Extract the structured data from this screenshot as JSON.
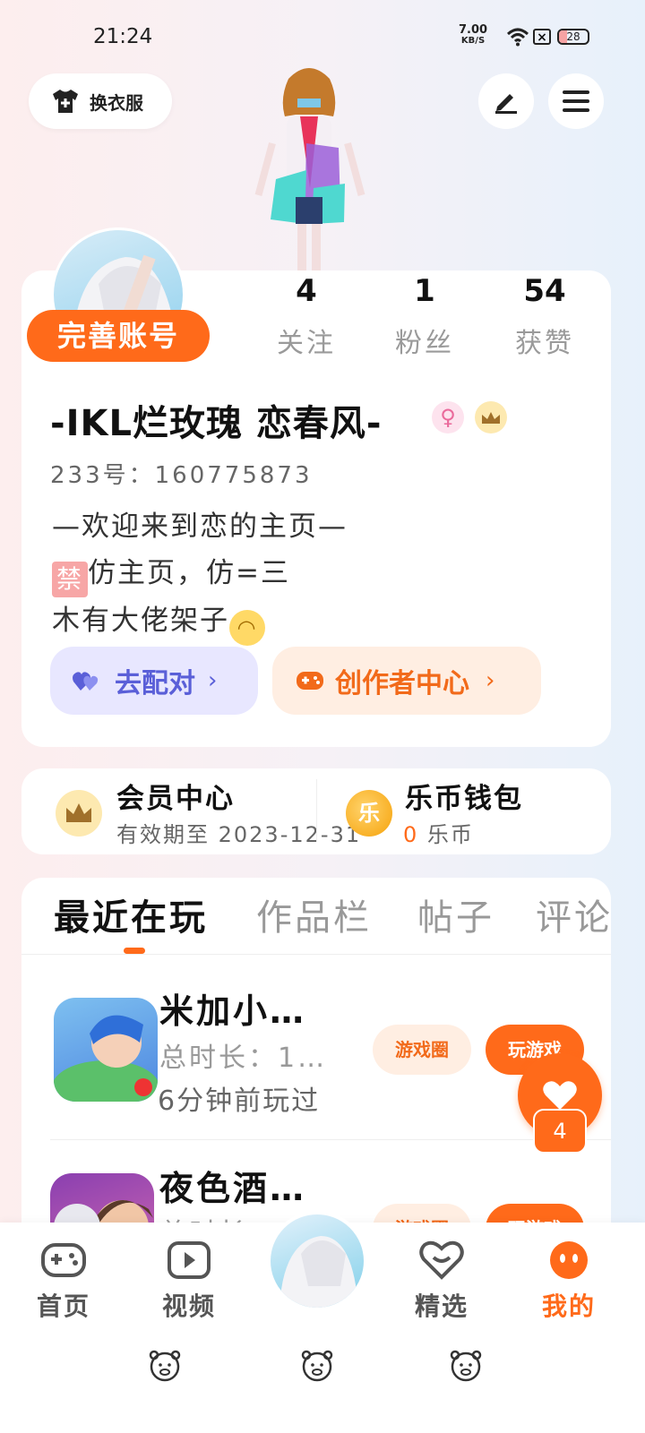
{
  "status_bar": {
    "time": "21:24",
    "net_speed": "7.00",
    "net_unit": "KB/S",
    "battery": "28",
    "battery_level": 0.28
  },
  "header": {
    "dress_label": "换衣服"
  },
  "profile": {
    "complete_badge": "完善账号",
    "stats": [
      {
        "num": "4",
        "label": "关注"
      },
      {
        "num": "1",
        "label": "粉丝"
      },
      {
        "num": "54",
        "label": "获赞"
      }
    ],
    "username": "-IKL烂玫瑰 恋春风-",
    "gender_symbol": "♀",
    "uid": "233号：160775873",
    "bio_line1": "—欢迎来到恋的主页—",
    "bio_ban": "禁",
    "bio_line2": "仿主页，仿=三",
    "bio_line3": "木有大佬架子",
    "pair_label": "去配对",
    "creator_label": "创作者中心",
    "arrow": "›"
  },
  "member": {
    "title": "会员中心",
    "subtitle": "有效期至 2023-12-31"
  },
  "wallet": {
    "title": "乐币钱包",
    "icon_text": "乐",
    "amount": "0",
    "unit": "乐币"
  },
  "tabs": [
    "最近在玩",
    "作品栏",
    "帖子",
    "评论"
  ],
  "games": [
    {
      "name": "米加小…",
      "meta": "总时长：1…",
      "time": "6分钟前玩过",
      "circle": "游戏圈",
      "play": "玩游戏"
    },
    {
      "name": "夜色酒…",
      "meta": "总时长",
      "time": "",
      "circle": "游戏圈",
      "play": "玩游戏"
    }
  ],
  "float": {
    "count": "4"
  },
  "nav": {
    "home": "首页",
    "video": "视频",
    "featured": "精选",
    "mine": "我的"
  },
  "colors": {
    "accent": "#ff6a1a",
    "pair": "#5a5fd8"
  }
}
